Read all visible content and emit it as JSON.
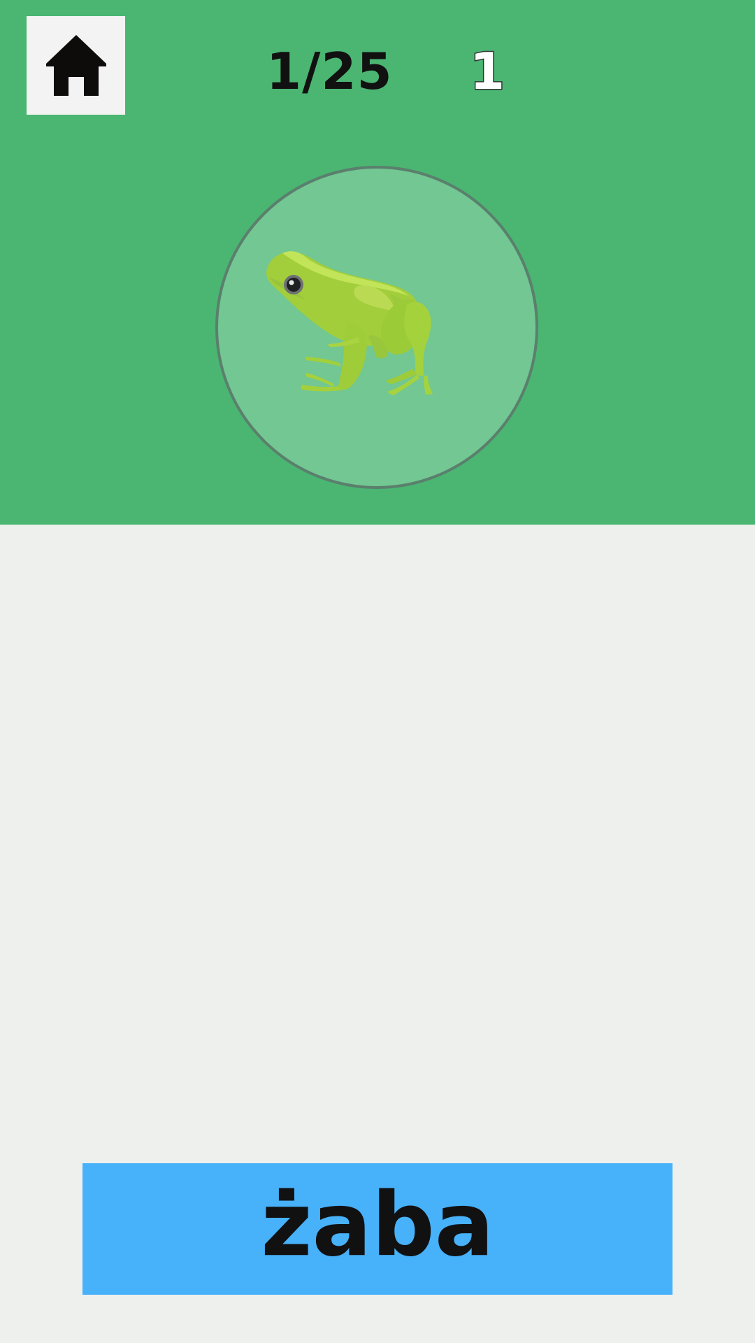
{
  "header": {
    "progress": "1/25",
    "score": "1",
    "home_icon": "home-icon"
  },
  "card": {
    "image": "frog-picture"
  },
  "answer": {
    "word": "żaba"
  },
  "colors": {
    "top_background": "#4AB672",
    "page_background": "#EEF0EE",
    "circle_fill": "#72C792",
    "circle_border": "#5B7F6D",
    "word_button": "#47B1F9",
    "text": "#111111"
  }
}
